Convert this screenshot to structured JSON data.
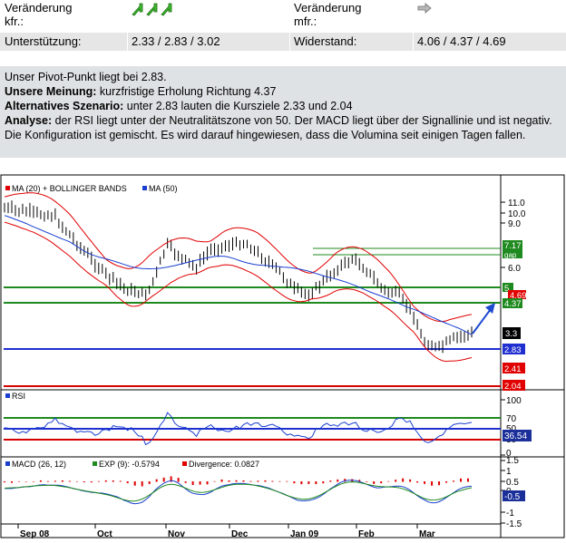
{
  "table": {
    "row1": {
      "label_left": "Veränderung\nkfr.:",
      "label_left_1": "Veränderung",
      "label_left_2": "kfr.:",
      "icons_left": [
        "arrow-up-icon",
        "arrow-up-icon",
        "arrow-up-icon"
      ],
      "label_right_1": "Veränderung",
      "label_right_2": "mfr.:",
      "icon_right": "arrow-right-icon"
    },
    "row2": {
      "support_label": "Unterstützung:",
      "support_value": "2.33 / 2.83 / 3.02",
      "resistance_label": "Widerstand:",
      "resistance_value": "4.06 / 4.37 / 4.69"
    }
  },
  "analysis": {
    "pivot": "Unser Pivot-Punkt liegt bei 2.83.",
    "opinion_label": "Unsere Meinung:",
    "opinion_text": " kurzfristige Erholung Richtung 4.37",
    "alt_label": "Alternatives Szenario:",
    "alt_text": " unter 2.83 lauten die Kursziele 2.33 und 2.04",
    "analysis_label": "Analyse:",
    "analysis_text": " der RSI liegt unter der Neutralitätszone von 50. Der MACD liegt über der Signallinie und ist negativ. Die Konfiguration ist gemischt. Es wird darauf hingewiesen, dass die Volumina seit einigen Tagen fallen."
  },
  "chart": {
    "price_legend": [
      "MA (20) + BOLLINGER BANDS",
      "MA (50)"
    ],
    "price_axis_ticks": [
      "11.0",
      "10.0",
      "9.0",
      "6.0"
    ],
    "level_labels": {
      "gap_top": "7.17",
      "gap_text": "gap",
      "l5": "5",
      "l469": "4.69",
      "l437": "4.37",
      "last": "3.3",
      "l283": "2.83",
      "l241": "2.41",
      "l204": "2.04"
    },
    "rsi_legend": "RSI",
    "rsi_ticks": [
      "100",
      "70",
      "50",
      "30",
      "0"
    ],
    "rsi_value": "36.54",
    "macd_legend": {
      "macd": "MACD (26, 12)",
      "exp": "EXP (9): -0.5794",
      "div": "Divergence: 0.0827"
    },
    "macd_ticks": [
      "1.5",
      "1",
      "0.5",
      "0",
      "-1",
      "-1.5"
    ],
    "macd_value": "-0.5",
    "months": [
      "Sep 08",
      "Oct",
      "Nov",
      "Dec",
      "Jan 09",
      "Feb",
      "Mar"
    ],
    "colors": {
      "boll": "#e00000",
      "ma50": "#1a3fcf",
      "green": "#1f8a1f",
      "blue_level": "#1f2fd0",
      "red_level": "#d40000",
      "panel_bg": "#ffffff"
    }
  }
}
